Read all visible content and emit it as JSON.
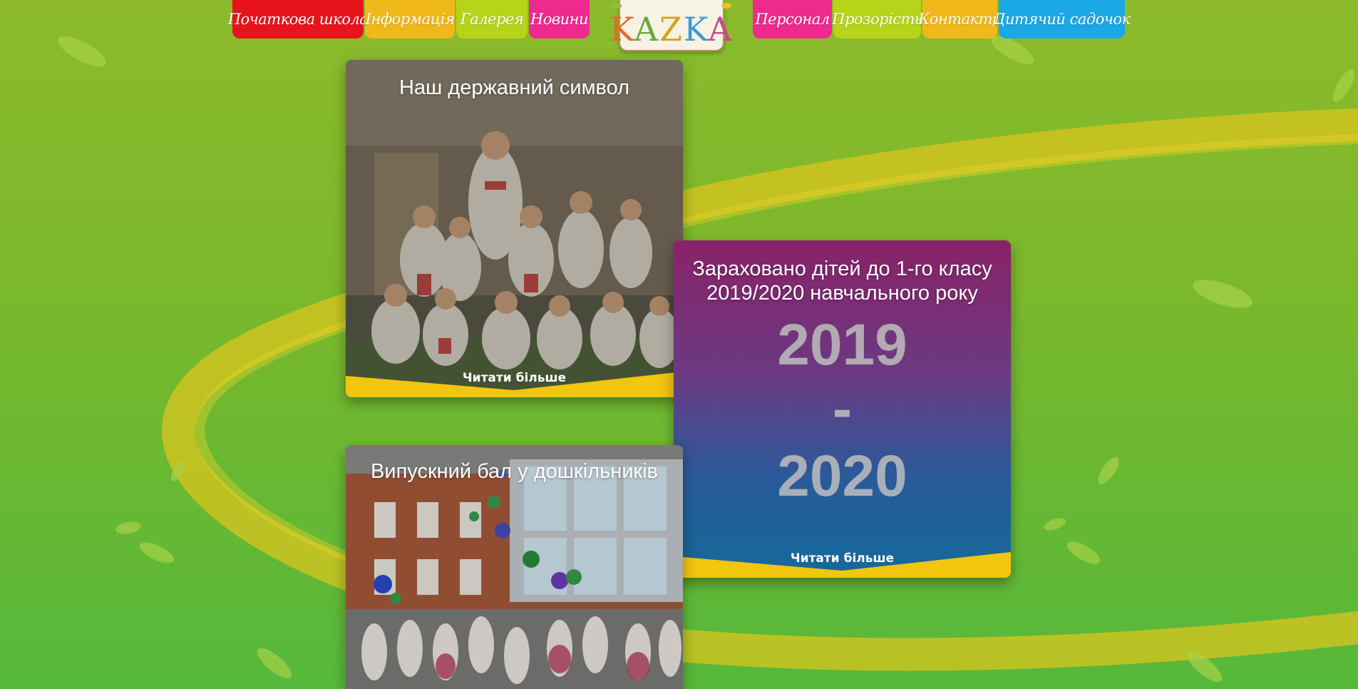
{
  "nav": {
    "left": [
      {
        "label": "Початкова школа",
        "color": "#e8141c"
      },
      {
        "label": "Інформація",
        "color": "#f0b818"
      },
      {
        "label": "Галерея",
        "color": "#b6d41a"
      },
      {
        "label": "Новини",
        "color": "#ee2a8e"
      }
    ],
    "right": [
      {
        "label": "Персонал",
        "color": "#ee2a8e"
      },
      {
        "label": "Прозорість",
        "color": "#b6d41a"
      },
      {
        "label": "Контакти",
        "color": "#f0b818"
      },
      {
        "label": "Дитячий садочок",
        "color": "#1ba8e6"
      }
    ]
  },
  "logo": {
    "text": "KAZKA"
  },
  "cards": [
    {
      "title": "Наш державний символ",
      "read_more": "Читати більше"
    },
    {
      "title": "Зараховано дітей до 1-го класу 2019/2020 навчального року",
      "year_start": "2019",
      "year_sep": "-",
      "year_end": "2020",
      "read_more": "Читати більше"
    },
    {
      "title": "Випускний бал у дошкільників"
    }
  ],
  "colors": {
    "accent_yellow": "#f2c50f",
    "card_purple": "#8a2a6e",
    "card_blue": "#1a6aa8"
  }
}
